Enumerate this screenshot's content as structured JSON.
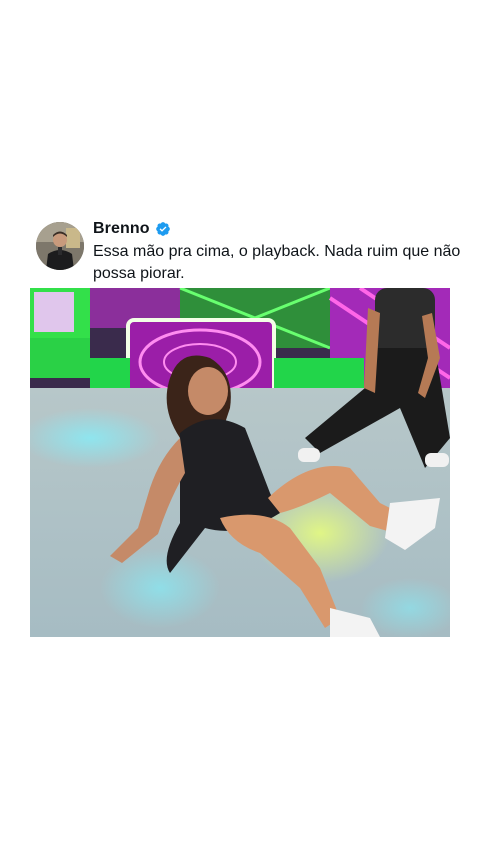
{
  "post": {
    "author_name": "Brenno",
    "verified_badge_color": "#1d9bf0",
    "text": "Essa mão pra cima, o playback. Nada ruim que não possa piorar."
  },
  "icons": {
    "verified": "verified-badge-icon",
    "avatar": "author-avatar"
  }
}
